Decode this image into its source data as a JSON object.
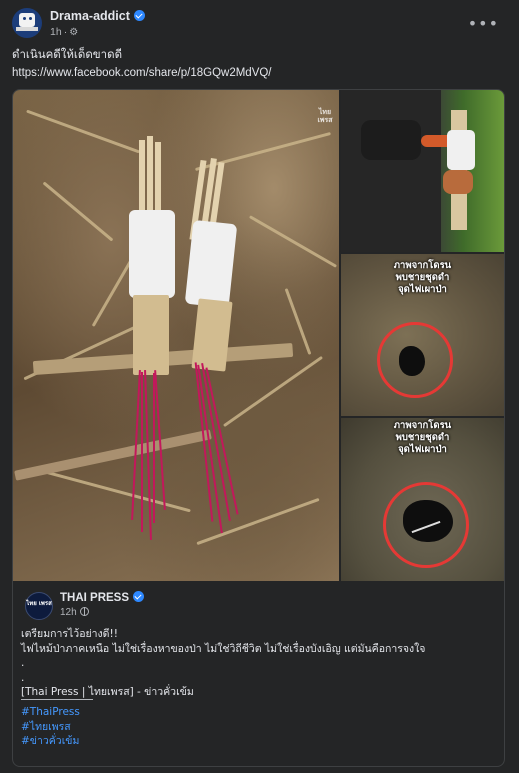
{
  "post": {
    "author": "Drama-addict",
    "time": "1h",
    "caption": "ดำเนินคดีให้เด็ดขาดดี",
    "link": "https://www.facebook.com/share/p/18GQw2MdVQ/"
  },
  "media": {
    "watermark": "ไทย เพรส",
    "overlay_mid": [
      "ภาพจากโดรน",
      "พบชายชุดดำ",
      "จุดไฟเผาป่า"
    ],
    "overlay_bottom": [
      "ภาพจากโดรน",
      "พบชายชุดดำ",
      "จุดไฟเผาป่า"
    ]
  },
  "shared": {
    "avatar_label": "ไทย เพรส",
    "page_name": "THAI PRESS",
    "time": "12h",
    "lines": [
      "เตรียมการไว้อย่างดี!!",
      "ไฟไหม้ป่าภาคเหนือ ไม่ใช่เรื่องหาของป่า ไม่ใช่วิถีชีวิต ไม่ใช่เรื่องบังเอิญ แต่มันคือการจงใจ",
      ".",
      ".",
      "[Thai Press | ไทยเพรส] - ข่าวคั่วเข้ม"
    ],
    "hashtags": [
      "#ThaiPress",
      "#ไทยเพรส",
      "#ข่าวคั่วเข้ม"
    ]
  },
  "colors": {
    "background": "#242526",
    "text": "#e4e6eb",
    "muted": "#b0b3b8",
    "link_blue": "#4599ff",
    "verified_blue": "#2d88ff",
    "incense_red": "#c2185b",
    "drone_circle": "#e53935"
  },
  "icons": [
    "verified-badge-icon",
    "settings-icon",
    "more-icon",
    "globe-icon"
  ]
}
